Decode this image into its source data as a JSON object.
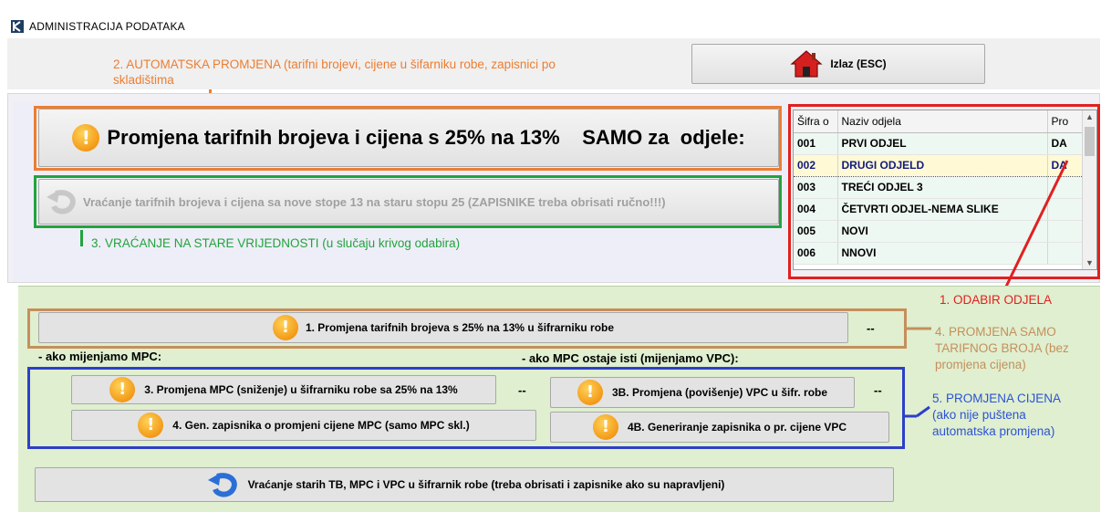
{
  "window": {
    "title": "ADMINISTRACIJA PODATAKA",
    "logo_icon": "app-k-logo-icon"
  },
  "exit_button": {
    "label": "Izlaz (ESC)",
    "icon": "house-icon"
  },
  "upper": {
    "main_button_label": "Promjena tarifnih brojeva i cijena s 25% na 13%    SAMO za  odjele:",
    "revert_button_label": "Vraćanje tarifnih brojeva i cijena sa nove stope 13 na staru stopu 25 (ZAPISNIKE treba obrisati ručno!!!)"
  },
  "table": {
    "columns": [
      "Šifra o",
      "Naziv odjela",
      "Pro"
    ],
    "rows": [
      {
        "code": "001",
        "name": "PRVI ODJEL",
        "pro": "DA"
      },
      {
        "code": "002",
        "name": "DRUGI ODJELD",
        "pro": "DA",
        "selected": true
      },
      {
        "code": "003",
        "name": "TREĆI ODJEL 3",
        "pro": ""
      },
      {
        "code": "004",
        "name": "ČETVRTI ODJEL-NEMA SLIKE",
        "pro": ""
      },
      {
        "code": "005",
        "name": "NOVI",
        "pro": ""
      },
      {
        "code": "006",
        "name": "NNOVI",
        "pro": ""
      }
    ]
  },
  "lower": {
    "btn1_label": "1. Promjena tarifnih brojeva s 25% na 13% u šifrarniku robe",
    "btn1_status": "--",
    "mpc_heading": "- ako mijenjamo MPC:",
    "vpc_heading": "- ako  MPC ostaje isti (mijenjamo VPC):",
    "btn3_label": "3. Promjena MPC (sniženje) u šifrarniku robe sa 25% na 13%",
    "btn3_status": "--",
    "btn3b_label": "3B. Promjena (povišenje) VPC u šifr. robe",
    "btn3b_status": "--",
    "btn4_label": "4. Gen. zapisnika o promjeni cijene MPC (samo MPC skl.)",
    "btn4b_label": "4B. Generiranje zapisnika o pr. cijene VPC",
    "revert_all_label": "Vraćanje starih TB, MPC i VPC u šifrarnik robe (treba obrisati i zapisnike ako su napravljeni)"
  },
  "annotations": {
    "a1": "1. ODABIR ODJELA",
    "a2_line1": "2. AUTOMATSKA PROMJENA (tarifni brojevi, cijene u šifarniku robe, zapisnici po",
    "a2_line2": "skladištima",
    "a3": "3. VRAĆANJE NA STARE VRIJEDNOSTI (u slučaju krivog odabira)",
    "a4_line1": "4. PROMJENA SAMO",
    "a4_line2": "TARIFNOG BROJA (bez",
    "a4_line3": "promjena cijena)",
    "a5_line1": "5. PROMJENA CIJENA",
    "a5_line2": "(ako nije puštena",
    "a5_line3": "automatska promjena)"
  },
  "colors": {
    "orange": "#ed7d31",
    "green": "#22a33d",
    "red": "#e02020",
    "brown": "#c58f5c",
    "blue": "#2d3fc8",
    "panel_green": "#dfefcf"
  }
}
